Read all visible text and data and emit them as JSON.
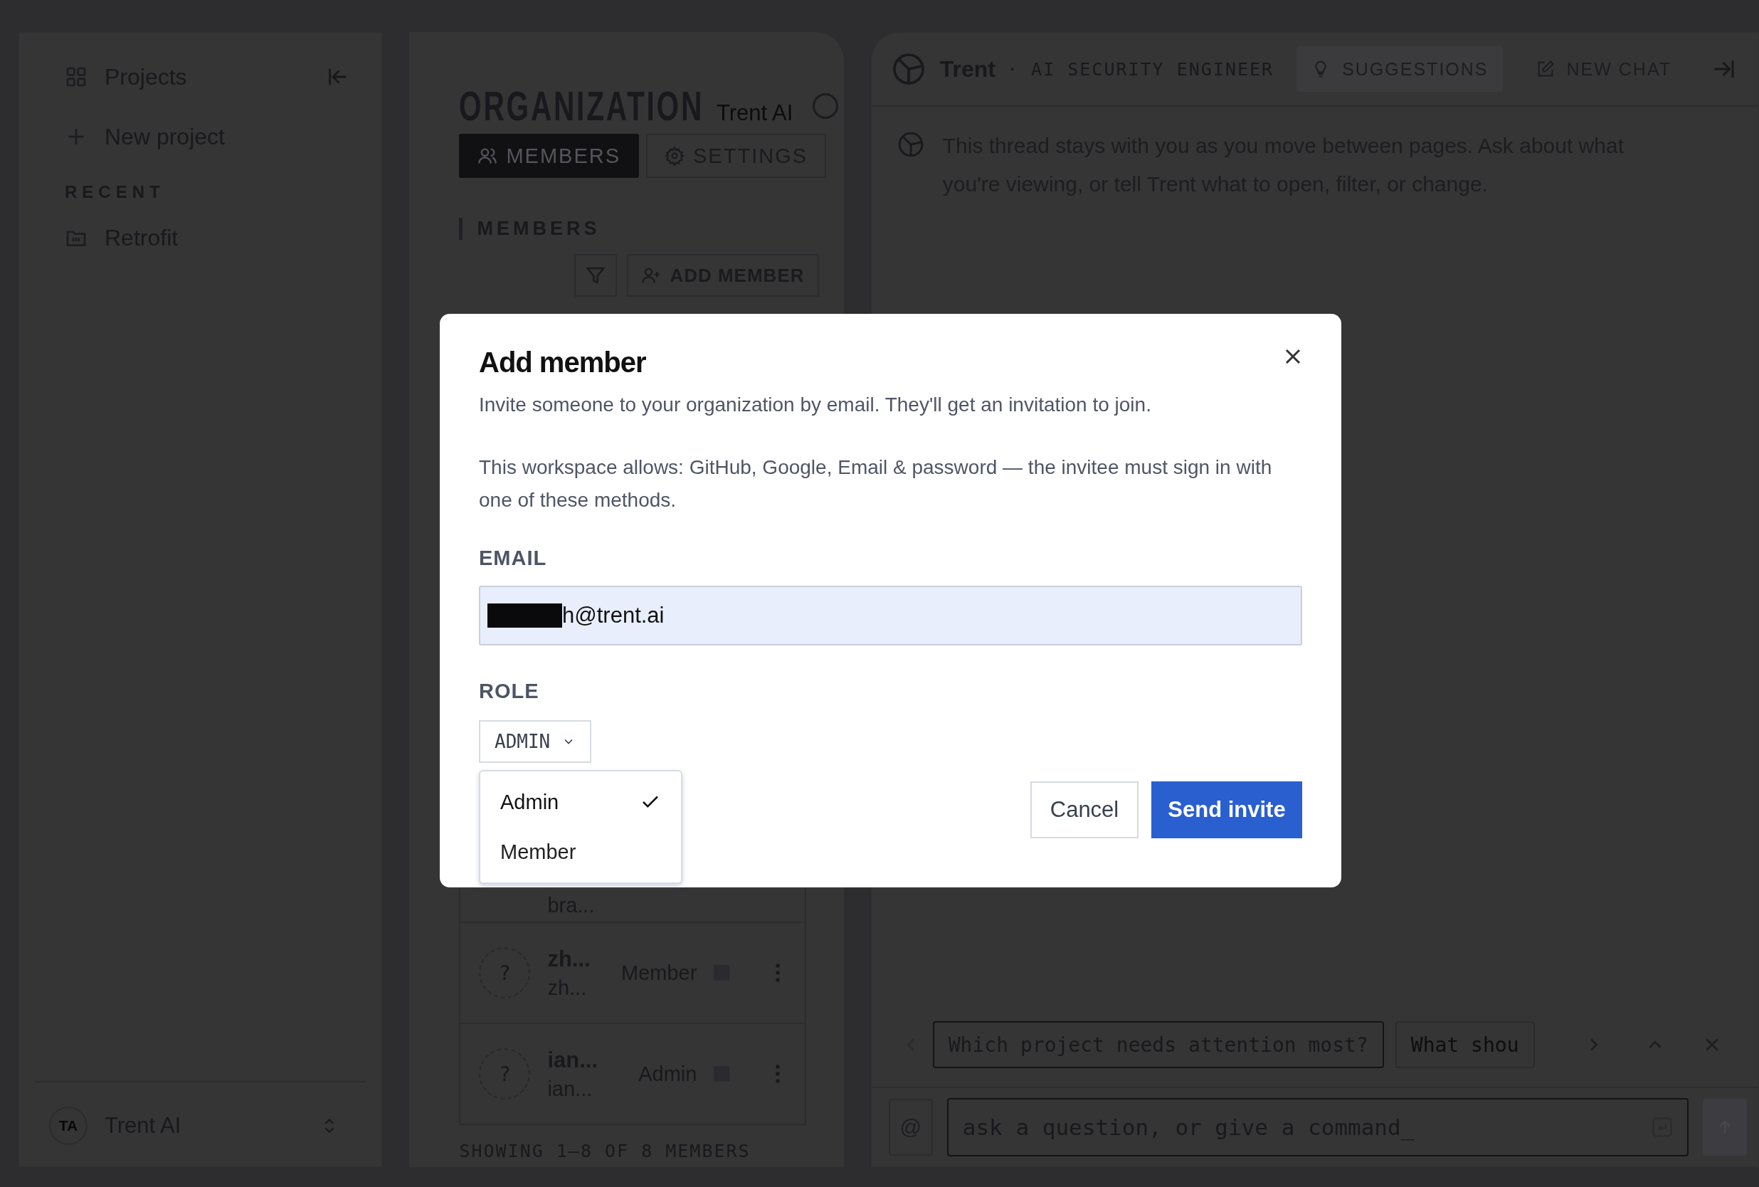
{
  "sidebar": {
    "items": [
      {
        "kind": "grid",
        "label": "Projects"
      },
      {
        "kind": "plus",
        "label": "New project"
      }
    ],
    "section_label": "RECENT",
    "recent": [
      {
        "label": "Retrofit"
      }
    ],
    "footer": {
      "initials": "TA",
      "name": "Trent AI"
    }
  },
  "organization": {
    "title": "ORGANIZATION",
    "subtitle": "Trent AI",
    "tabs": [
      {
        "label": "MEMBERS",
        "kind": "people",
        "selected": true
      },
      {
        "label": "SETTINGS",
        "kind": "gear",
        "selected": false
      }
    ],
    "section_title": "MEMBERS",
    "add_button": "ADD MEMBER",
    "rows": [
      {
        "email": "bra..."
      },
      {
        "avatar": "?",
        "name": "zh...",
        "email": "zh...",
        "role": "Member"
      },
      {
        "avatar": "?",
        "name": "ian...",
        "email": "ian...",
        "role": "Admin"
      }
    ],
    "footer": "SHOWING 1–8 OF 8 MEMBERS"
  },
  "assistant": {
    "name": "Trent",
    "subtitle": "· AI SECURITY ENGINEER",
    "suggestions_button": "SUGGESTIONS",
    "new_chat_button": "NEW CHAT",
    "message": "This thread stays with you as you move between pages. Ask about what you're viewing, or tell Trent what to open, filter, or change.",
    "chips": [
      "Which project needs attention most?",
      "What shou"
    ],
    "input": {
      "at": "@",
      "placeholder": "ask a question, or give a command_"
    }
  },
  "modal": {
    "title": "Add member",
    "description": "Invite someone to your organization by email. They'll get an invitation to join.",
    "methods": "This workspace allows: GitHub, Google, Email & password — the invitee must sign in with one of these methods.",
    "email_label": "EMAIL",
    "email_value": "h@trent.ai",
    "role_label": "ROLE",
    "role_value": "ADMIN",
    "role_options": [
      {
        "label": "Admin",
        "selected": true
      },
      {
        "label": "Member",
        "selected": false
      }
    ],
    "cancel": "Cancel",
    "submit": "Send invite"
  }
}
